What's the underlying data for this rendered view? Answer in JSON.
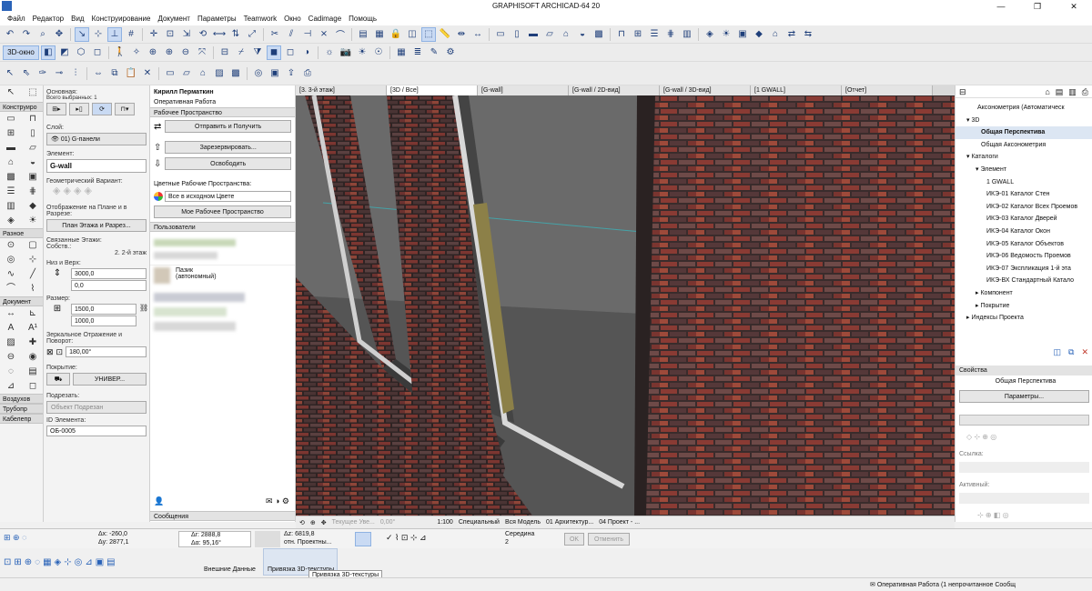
{
  "window": {
    "title": "GRAPHISOFT ARCHICAD-64 20"
  },
  "menu": [
    "Файл",
    "Редактор",
    "Вид",
    "Конструирование",
    "Документ",
    "Параметры",
    "Teamwork",
    "Окно",
    "Cadimage",
    "Помощь"
  ],
  "toolbar": {
    "view3d_label": "3D-окно"
  },
  "toolbox": {
    "sec_construct": "Конструиро",
    "sec_misc": "Разное",
    "sec_doc": "Документ",
    "sec_air": "Воздухов",
    "sec_pipe": "Трубопр",
    "sec_cable": "Кабелепр"
  },
  "info": {
    "main_label": "Основная:",
    "selected_label": "Всего выбранных: 1",
    "layer_label": "Слой:",
    "layer_value": "01) G-панели",
    "element_label": "Элемент:",
    "element_value": "G-wall",
    "geom_label": "Геометрический Вариант:",
    "display_label": "Отображение на Плане и в Разрезе:",
    "display_value": "План Этажа и Разрез...",
    "links_label": "Связанные Этажи:",
    "own_label": "Собств.:",
    "floors_value": "2. 2-й этаж",
    "bottomtop_label": "Низ и Верх:",
    "top_value": "3000,0",
    "bottom_value": "0,0",
    "size_label": "Размер:",
    "width_value": "1500,0",
    "height_value": "1000,0",
    "mirror_label": "Зеркальное Отражение и Поворот:",
    "angle_value": "180,00°",
    "cover_label": "Покрытие:",
    "cover_value": "УНИВЕР...",
    "sub_label": "Подрезать:",
    "sub_value": "Объект Подрезан",
    "id_label": "ID Элемента:",
    "id_value": "ОБ-0005"
  },
  "team": {
    "user": "Кирилл Перматкин",
    "mode": "Оперативная Работа",
    "workspace_header": "Рабочее Пространство",
    "send_button": "Отправить и Получить",
    "reserved_button": "Зарезервировать...",
    "free_button": "Освободить",
    "color_label": "Цветные Рабочие Пространства:",
    "color_value": "Все в исходном Цвете",
    "my_space_button": "Мое Рабочее Пространство",
    "users_header": "Пользователи",
    "user2_name": "Пазик",
    "user2_mode": "(автономный)",
    "messages_header": "Сообщения"
  },
  "tabs": [
    "[3. 3-й этаж]",
    "[3D / Все]",
    "[G-wall]",
    "[G-wall / 2D-вид]",
    "[G-wall / 3D-вид]",
    "[1 GWALL]",
    "[Отчет]"
  ],
  "statusbar": {
    "current": "Текущее Уве...",
    "angle": "0,00°",
    "scale": "1:100",
    "special": "Специальный",
    "model": "Вся Модель",
    "architect": "01 Архитектур...",
    "project": "04 Проект - ..."
  },
  "navigator": {
    "items": [
      "Аксонометрия (Автоматическ",
      "3D",
      "Общая Перспектива",
      "Общая Аксонометрия",
      "Каталоги",
      "Элемент",
      "1 GWALL",
      "ИКЭ-01 Каталог Стен",
      "ИКЭ-02 Каталог Всех Проемов",
      "ИКЭ-03 Каталог Дверей",
      "ИКЭ-04 Каталог Окон",
      "ИКЭ-05 Каталог Объектов",
      "ИКЭ-06 Ведомость Проемов",
      "ИКЭ-07 Экспликация 1-й эта",
      "ИКЭ-ВХ Стандартный Катало",
      "Компонент",
      "Покрытие",
      "Индексы Проекта"
    ],
    "props_header": "Свойства",
    "props_value": "Общая Перспектива",
    "params_button": "Параметры...",
    "link_label": "Ссылка:",
    "active_label": "Активный:"
  },
  "coords": {
    "dx": "Δx: -260,0",
    "dy": "Δy: 2877,1",
    "dr": "Δr: 2888,8",
    "da": "Δα: 95,16°",
    "dz": "Δz: 6819,8",
    "rel": "отн. Проектны...",
    "center": "Середина",
    "center_value": "2",
    "ok": "OK",
    "cancel": "Отменить"
  },
  "bottom": {
    "external": "Внешние Данные",
    "texture": "Привязка 3D-текстуры",
    "tooltip": "Привязка 3D-текстуры"
  },
  "footer": {
    "status": "Оперативная Работа (1 непрочитанное Сообщ"
  },
  "colors": {
    "brick_red": "#8a3b34",
    "brick_dark": "#3d2b2b",
    "concrete": "#6a6a6a",
    "accent": "#2a63b8"
  }
}
